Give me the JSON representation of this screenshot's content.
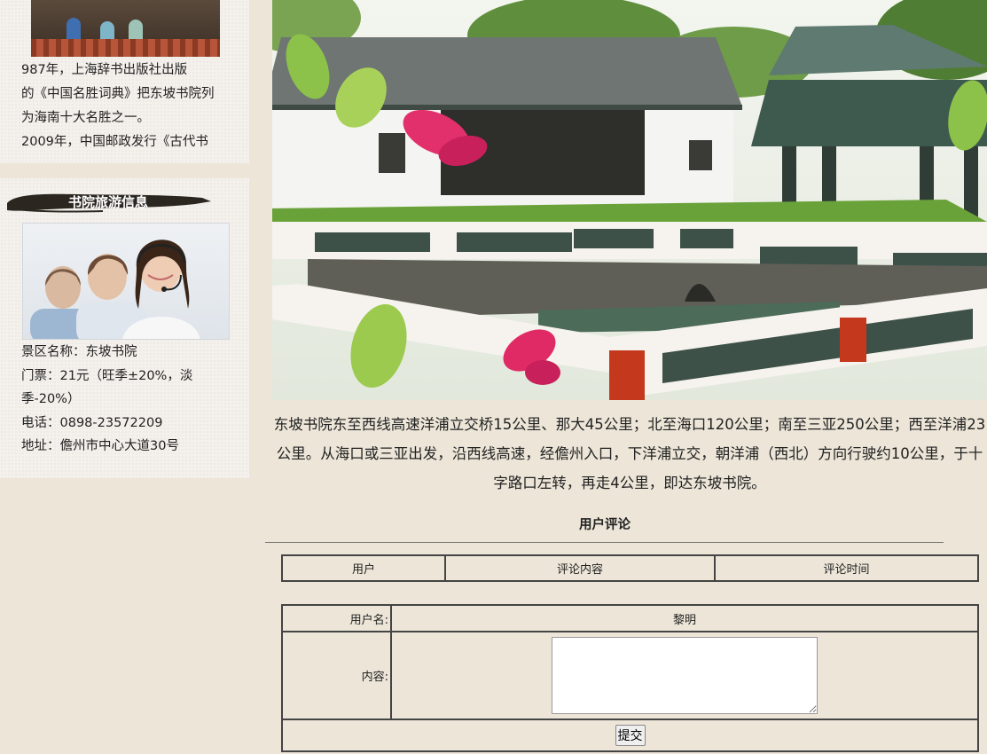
{
  "sidebar": {
    "intro_text": "    987年，上海辞书出版社出版\n的《中国名胜词典》把东坡书院列\n为海南十大名胜之一。\n2009年，中国邮政发行《古代书",
    "info_title": "书院旅游信息",
    "info_lines": [
      "景区名称：东坡书院",
      "门票：21元（旺季±20%，淡季-20%）",
      "电话：0898-23572209",
      "地址：儋州市中心大道30号"
    ]
  },
  "main": {
    "directions": "东坡书院东至西线高速洋浦立交桥15公里、那大45公里；北至海口120公里；南至三亚250公里；西至洋浦23公里。从海口或三亚出发，沿西线高速，经儋州入口，下洋浦立交，朝洋浦（西北）方向行驶约10公里，于十字路口左转，再走4公里，即达东坡书院。"
  },
  "reviews": {
    "title": "用户评论",
    "columns": [
      "用户",
      "评论内容",
      "评论时间"
    ]
  },
  "form": {
    "username_label": "用户名:",
    "username_value": "黎明",
    "content_label": "内容:",
    "content_value": "",
    "submit_label": "提交"
  },
  "colors": {
    "page_bg": "#ece5d8",
    "panel_bg": "#f4f1ec",
    "brush_banner": "#2b2620"
  }
}
